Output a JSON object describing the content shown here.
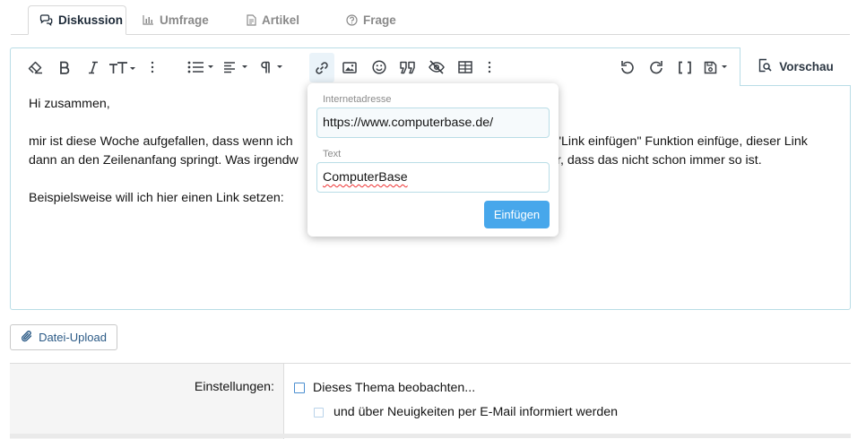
{
  "tabs": [
    {
      "label": "Diskussion",
      "icon": "speech-bubbles-icon",
      "active": true
    },
    {
      "label": "Umfrage",
      "icon": "bar-chart-icon",
      "active": false
    },
    {
      "label": "Artikel",
      "icon": "document-icon",
      "active": false
    },
    {
      "label": "Frage",
      "icon": "question-circle-icon",
      "active": false
    }
  ],
  "toolbar": {
    "left_icons": [
      "eraser-icon",
      "bold-icon",
      "italic-icon",
      "text-size-icon",
      "more-dots-icon",
      "list-icon",
      "align-icon",
      "paragraph-icon",
      "link-icon",
      "image-icon",
      "smiley-icon",
      "quote-icon",
      "hide-icon",
      "table-icon",
      "more-dots-icon"
    ],
    "right_icons": [
      "undo-icon",
      "redo-icon",
      "bbcode-brackets-icon",
      "save-draft-icon"
    ],
    "preview_label": "Vorschau"
  },
  "content": {
    "greeting": "Hi zusammen,",
    "line1": "mir ist diese Woche aufgefallen, dass wenn ich einen Link mit der \"Link einfügen\" Funktion einfüge, dieser Link",
    "line1_left": "mir ist diese Woche aufgefallen, dass wenn ich ",
    "line1_right": "\"Link einfügen\" Funktion einfüge, dieser Link",
    "line2_left": "dann an den Zeilenanfang springt. Was irgendw",
    "line2_right": "r, dass das nicht schon immer so ist.",
    "line3": "Beispielsweise will ich hier einen Link setzen:"
  },
  "link_popup": {
    "url_label": "Internetadresse",
    "url_value": "https://www.computerbase.de/",
    "text_label": "Text",
    "text_value": "ComputerBase",
    "insert_label": "Einfügen"
  },
  "upload": {
    "label": "Datei-Upload"
  },
  "settings": {
    "label": "Einstellungen:",
    "watch_label": "Dieses Thema beobachten...",
    "email_label": "und über Neuigkeiten per E-Mail informiert werden"
  },
  "colors": {
    "accent": "#47a7eb",
    "border": "#b9dde6",
    "link": "#2b5a86"
  }
}
